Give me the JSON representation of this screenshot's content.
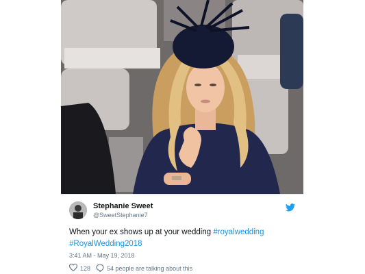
{
  "tweet": {
    "display_name": "Stephanie Sweet",
    "handle": "@SweetStephanie7",
    "text_plain": "When your ex shows up at your wedding ",
    "hashtag_1": "#royalwedding",
    "hashtag_2": "#RoyalWedding2018",
    "timestamp": "3:41 AM - May 19, 2018",
    "like_count": "128",
    "reply_text": "54 people are talking about this"
  },
  "icons": {
    "bird": "twitter-bird-icon",
    "like": "heart-icon",
    "reply": "comment-bubble-icon"
  },
  "colors": {
    "link": "#1b95e0",
    "secondary_text": "#657786",
    "primary_text": "#14171a",
    "dress": "#22284d",
    "hair": "#d9b77a"
  }
}
